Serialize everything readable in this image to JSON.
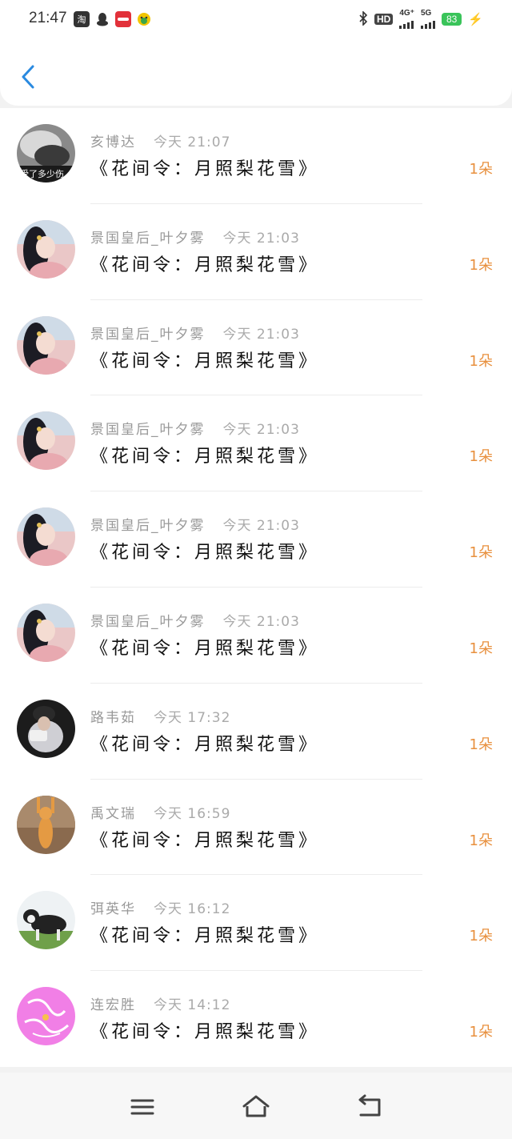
{
  "status_bar": {
    "time": "21:47",
    "app_icons": [
      {
        "name": "taobao-icon",
        "glyph": "淘",
        "color": "#333333"
      },
      {
        "name": "qq-icon",
        "glyph": "🐧",
        "color": "#333333"
      },
      {
        "name": "news-app-icon",
        "glyph": "●",
        "color": "#e2313a"
      },
      {
        "name": "emoji-app-icon",
        "glyph": "☺",
        "color": "#f2c500"
      }
    ],
    "hd_label": "HD",
    "network_4g": "4G⁺",
    "network_5g": "5G",
    "battery": "83"
  },
  "header": {
    "back_icon": "chevron-left-icon",
    "accent": "#2a8ae0"
  },
  "list": [
    {
      "name": "亥博达",
      "time": "今天 21:07",
      "title": "《花间令：月照梨花雪》",
      "count": "1朵",
      "avatar": "avatar-bw"
    },
    {
      "name": "景国皇后_叶夕雾",
      "time": "今天 21:03",
      "title": "《花间令：月照梨花雪》",
      "count": "1朵",
      "avatar": "avatar-girl"
    },
    {
      "name": "景国皇后_叶夕雾",
      "time": "今天 21:03",
      "title": "《花间令：月照梨花雪》",
      "count": "1朵",
      "avatar": "avatar-girl"
    },
    {
      "name": "景国皇后_叶夕雾",
      "time": "今天 21:03",
      "title": "《花间令：月照梨花雪》",
      "count": "1朵",
      "avatar": "avatar-girl"
    },
    {
      "name": "景国皇后_叶夕雾",
      "time": "今天 21:03",
      "title": "《花间令：月照梨花雪》",
      "count": "1朵",
      "avatar": "avatar-girl"
    },
    {
      "name": "景国皇后_叶夕雾",
      "time": "今天 21:03",
      "title": "《花间令：月照梨花雪》",
      "count": "1朵",
      "avatar": "avatar-girl"
    },
    {
      "name": "路韦茹",
      "time": "今天 17:32",
      "title": "《花间令：月照梨花雪》",
      "count": "1朵",
      "avatar": "avatar-dark"
    },
    {
      "name": "禹文瑞",
      "time": "今天 16:59",
      "title": "《花间令：月照梨花雪》",
      "count": "1朵",
      "avatar": "avatar-cat"
    },
    {
      "name": "弭英华",
      "time": "今天 16:12",
      "title": "《花间令：月照梨花雪》",
      "count": "1朵",
      "avatar": "avatar-dog"
    },
    {
      "name": "连宏胜",
      "time": "今天 14:12",
      "title": "《花间令：月照梨花雪》",
      "count": "1朵",
      "avatar": "avatar-pink"
    }
  ],
  "nav": {
    "menu_icon": "menu-icon",
    "home_icon": "home-icon",
    "back_icon": "return-icon"
  },
  "colors": {
    "count": "#e8903e",
    "name": "#999999",
    "title": "#111111"
  }
}
